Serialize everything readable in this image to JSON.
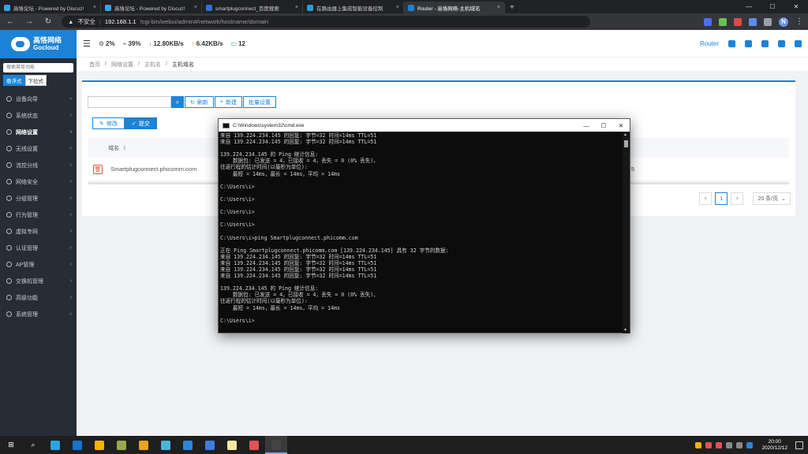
{
  "browser": {
    "tabs": [
      {
        "title": "高恪论坛 - Powered by Discuz!",
        "color": "#3ba0e6",
        "active": false
      },
      {
        "title": "高恪论坛 - Powered by Discuz!",
        "color": "#3ba0e6",
        "active": false
      },
      {
        "title": "smartplugconnect_百度搜索",
        "color": "#2f6fe0",
        "active": false
      },
      {
        "title": "在路由器上集成智能设备控制",
        "color": "#2a9bd8",
        "active": false
      },
      {
        "title": "Router - 高恪网络-主机域名",
        "color": "#1d83d6",
        "active": true
      }
    ],
    "tab_close": "×",
    "new_tab": "+",
    "security_label": "不安全",
    "url_host": "192.168.1.1",
    "url_path": "/cgi-bin/webui/admin#/network/hostname/domain",
    "profile_initial": "N"
  },
  "sidebar": {
    "logo_cn": "高恪网络",
    "logo_en": "Gocloud",
    "search_placeholder": "搜索菜单功能",
    "mode_tabs": [
      "悬浮式",
      "下拉式"
    ],
    "items": [
      {
        "label": "设备向导"
      },
      {
        "label": "系统状态"
      },
      {
        "label": "网络设置",
        "active": true
      },
      {
        "label": "无线设置"
      },
      {
        "label": "流控分线"
      },
      {
        "label": "网络安全"
      },
      {
        "label": "分组管理"
      },
      {
        "label": "行为管理"
      },
      {
        "label": "虚拟专网"
      },
      {
        "label": "认证管理"
      },
      {
        "label": "AP管理"
      },
      {
        "label": "交换机管理"
      },
      {
        "label": "高级功能"
      },
      {
        "label": "系统管理"
      }
    ]
  },
  "header": {
    "cpu": "2%",
    "mem": "39%",
    "down": "12.80KB/s",
    "up": "6.42KB/s",
    "clients": "12",
    "router_label": "Router"
  },
  "breadcrumb": [
    "首页",
    "网络设置",
    "主机名",
    "主机域名"
  ],
  "toolbar": {
    "refresh": "刷新",
    "add": "新建",
    "batch": "批量设置",
    "edit": "修改",
    "submit": "提交"
  },
  "table": {
    "column": "域名",
    "rows": [
      {
        "domain": "Smartplugconnect.phicomm.com",
        "extra": "5"
      }
    ]
  },
  "pagination": {
    "prev": "<",
    "current": "1",
    "next": ">",
    "page_size": "20 条/页"
  },
  "cmd": {
    "title": "C:\\Windows\\system32\\cmd.exe",
    "lines": [
      "来自 139.224.234.145 的回复: 字节=32 时间=14ms TTL=51",
      "来自 139.224.234.145 的回复: 字节=32 时间=14ms TTL=51",
      "",
      "139.224.234.145 的 Ping 统计信息:",
      "    数据包: 已发送 = 4，已接收 = 4，丢失 = 0 (0% 丢失)，",
      "往返行程的估计时间(以毫秒为单位):",
      "    最短 = 14ms，最长 = 14ms，平均 = 14ms",
      "",
      "C:\\Users\\i>",
      "",
      "C:\\Users\\i>",
      "",
      "C:\\Users\\i>",
      "",
      "C:\\Users\\i>",
      "",
      "C:\\Users\\i>ping Smartplugconnect.phicomm.com",
      "",
      "正在 Ping Smartplugconnect.phicomm.com [139.224.234.145] 具有 32 字节的数据:",
      "来自 139.224.234.145 的回复: 字节=32 时间=14ms TTL=51",
      "来自 139.224.234.145 的回复: 字节=32 时间=14ms TTL=51",
      "来自 139.224.234.145 的回复: 字节=32 时间=14ms TTL=51",
      "来自 139.224.234.145 的回复: 字节=32 时间=14ms TTL=51",
      "",
      "139.224.234.145 的 Ping 统计信息:",
      "    数据包: 已发送 = 4，已接收 = 4，丢失 = 0 (0% 丢失)，",
      "往返行程的估计时间(以毫秒为单位):",
      "    最短 = 14ms，最长 = 14ms，平均 = 14ms",
      "",
      "C:\\Users\\i>"
    ]
  },
  "taskbar": {
    "apps": [
      {
        "name": "edge",
        "color": "#2fa3e0"
      },
      {
        "name": "hp",
        "color": "#1a73c8"
      },
      {
        "name": "shield",
        "color": "#f4b400"
      },
      {
        "name": "plant",
        "color": "#9aa84a"
      },
      {
        "name": "chrome",
        "color": "#e8a31f"
      },
      {
        "name": "photo",
        "color": "#4fb3d9"
      },
      {
        "name": "vscode",
        "color": "#2c86d8"
      },
      {
        "name": "bird",
        "color": "#3d7de0"
      },
      {
        "name": "scan",
        "color": "#f5e6a0"
      },
      {
        "name": "editor",
        "color": "#e05353"
      },
      {
        "name": "cmd",
        "color": "#444444",
        "active": true
      }
    ],
    "time": "20:00",
    "date": "2020/12/12"
  },
  "colors": {
    "accent": "#1d83d6",
    "sidebar_bg": "#272d36",
    "console_bg": "#0c0c0c"
  }
}
